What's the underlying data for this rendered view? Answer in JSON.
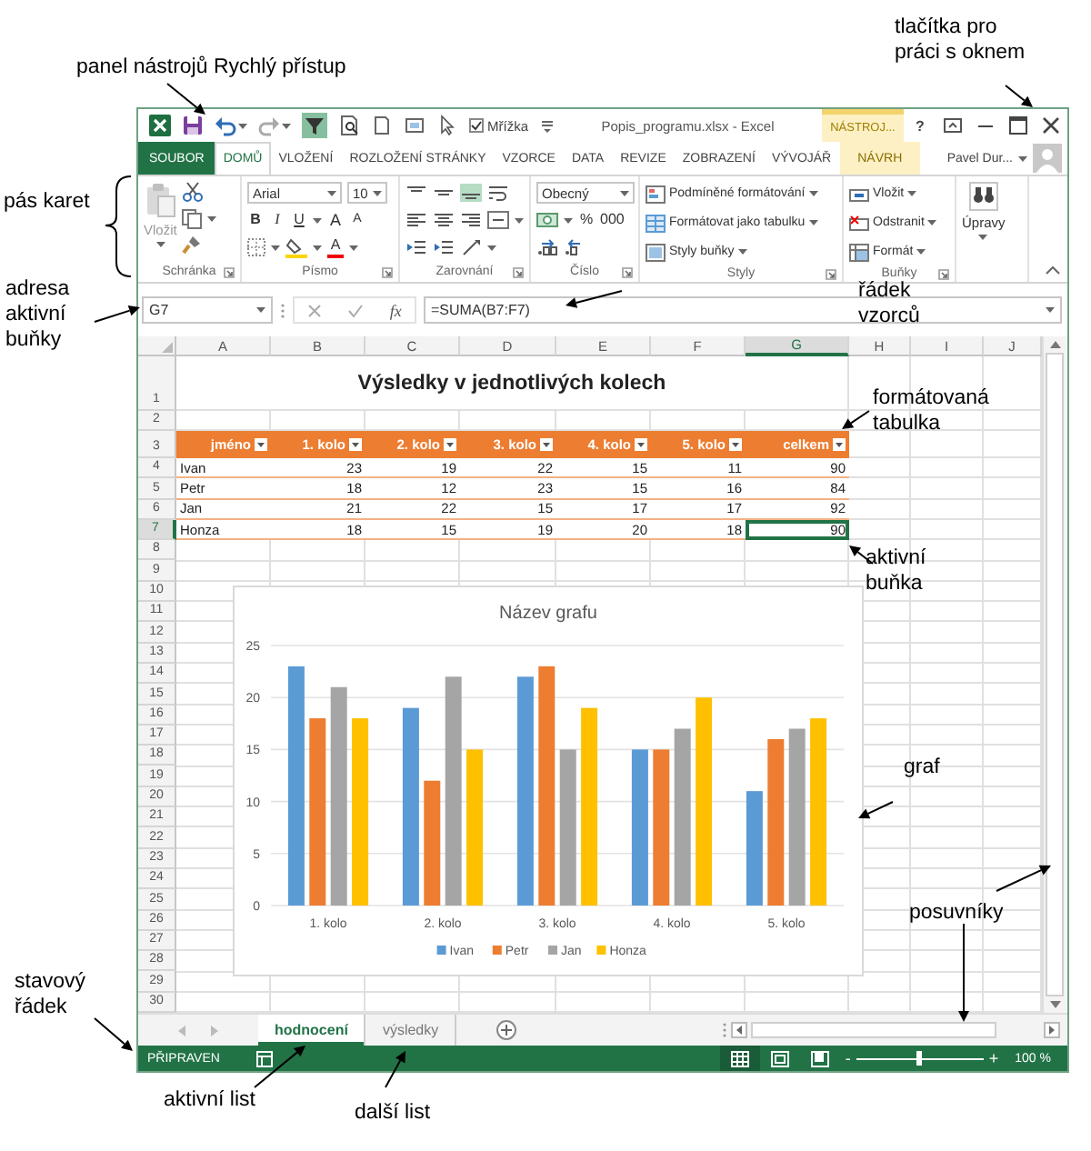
{
  "window": {
    "title": "Popis_programu.xlsx - Excel",
    "context_label": "NÁSTROJ...",
    "help": "?",
    "grid_option": {
      "label": "Mřížka",
      "checked": true
    }
  },
  "ribbon_tabs": [
    {
      "label": "SOUBOR",
      "kind": "file",
      "selected": false
    },
    {
      "label": "DOMŮ",
      "kind": "tab",
      "selected": true
    },
    {
      "label": "VLOŽENÍ",
      "kind": "tab",
      "selected": false
    },
    {
      "label": "ROZLOŽENÍ STRÁNKY",
      "kind": "tab",
      "selected": false
    },
    {
      "label": "VZORCE",
      "kind": "tab",
      "selected": false
    },
    {
      "label": "DATA",
      "kind": "tab",
      "selected": false
    },
    {
      "label": "REVIZE",
      "kind": "tab",
      "selected": false
    },
    {
      "label": "ZOBRAZENÍ",
      "kind": "tab",
      "selected": false
    },
    {
      "label": "VÝVOJÁŘ",
      "kind": "tab",
      "selected": false
    },
    {
      "label": "NÁVRH",
      "kind": "contextual",
      "selected": false
    }
  ],
  "user": {
    "name": "Pavel Dur..."
  },
  "ribbon": {
    "clipboard": {
      "label": "Schránka",
      "paste": "Vložit"
    },
    "font": {
      "label": "Písmo",
      "name": "Arial",
      "size": "10",
      "bold": "B",
      "italic": "I",
      "underline": "U",
      "grow": "A",
      "shrink": "A",
      "font_tint": "A"
    },
    "alignment": {
      "label": "Zarovnání"
    },
    "number": {
      "label": "Číslo",
      "format": "Obecný",
      "percent": "%",
      "thousands": "000"
    },
    "styles": {
      "label": "Styly",
      "items": [
        "Podmíněné formátování",
        "Formátovat jako tabulku",
        "Styly buňky"
      ]
    },
    "cells": {
      "label": "Buňky",
      "items": [
        "Vložit",
        "Odstranit",
        "Formát"
      ]
    },
    "editing": {
      "label": "Úpravy"
    }
  },
  "formula_bar": {
    "cell_address": "G7",
    "fx": "fx",
    "formula": "=SUMA(B7:F7)"
  },
  "sheet": {
    "columns": [
      {
        "label": "A",
        "selected": false
      },
      {
        "label": "B",
        "selected": false
      },
      {
        "label": "C",
        "selected": false
      },
      {
        "label": "D",
        "selected": false
      },
      {
        "label": "E",
        "selected": false
      },
      {
        "label": "F",
        "selected": false
      },
      {
        "label": "G",
        "selected": true
      },
      {
        "label": "H",
        "selected": false
      },
      {
        "label": "I",
        "selected": false
      },
      {
        "label": "J",
        "selected": false
      }
    ],
    "rows": [
      {
        "label": "1",
        "selected": false
      },
      {
        "label": "2",
        "selected": false
      },
      {
        "label": "3",
        "selected": false
      },
      {
        "label": "4",
        "selected": false
      },
      {
        "label": "5",
        "selected": false
      },
      {
        "label": "6",
        "selected": false
      },
      {
        "label": "7",
        "selected": true
      },
      {
        "label": "8",
        "selected": false
      },
      {
        "label": "9",
        "selected": false
      },
      {
        "label": "10",
        "selected": false
      },
      {
        "label": "11",
        "selected": false
      },
      {
        "label": "12",
        "selected": false
      },
      {
        "label": "13",
        "selected": false
      },
      {
        "label": "14",
        "selected": false
      },
      {
        "label": "15",
        "selected": false
      },
      {
        "label": "16",
        "selected": false
      },
      {
        "label": "17",
        "selected": false
      },
      {
        "label": "18",
        "selected": false
      },
      {
        "label": "19",
        "selected": false
      },
      {
        "label": "20",
        "selected": false
      },
      {
        "label": "21",
        "selected": false
      },
      {
        "label": "22",
        "selected": false
      },
      {
        "label": "23",
        "selected": false
      },
      {
        "label": "24",
        "selected": false
      },
      {
        "label": "25",
        "selected": false
      },
      {
        "label": "26",
        "selected": false
      },
      {
        "label": "27",
        "selected": false
      },
      {
        "label": "28",
        "selected": false
      },
      {
        "label": "29",
        "selected": false
      },
      {
        "label": "30",
        "selected": false
      }
    ],
    "title": "Výsledky v jednotlivých kolech",
    "table": {
      "columns": [
        "jméno",
        "1. kolo",
        "2. kolo",
        "3. kolo",
        "4. kolo",
        "5. kolo",
        "celkem"
      ],
      "rows": [
        {
          "cells": [
            {
              "text": "Ivan",
              "selected": false
            },
            {
              "text": "23",
              "selected": false
            },
            {
              "text": "19",
              "selected": false
            },
            {
              "text": "22",
              "selected": false
            },
            {
              "text": "15",
              "selected": false
            },
            {
              "text": "11",
              "selected": false
            },
            {
              "text": "90",
              "selected": false
            }
          ]
        },
        {
          "cells": [
            {
              "text": "Petr",
              "selected": false
            },
            {
              "text": "18",
              "selected": false
            },
            {
              "text": "12",
              "selected": false
            },
            {
              "text": "23",
              "selected": false
            },
            {
              "text": "15",
              "selected": false
            },
            {
              "text": "16",
              "selected": false
            },
            {
              "text": "84",
              "selected": false
            }
          ]
        },
        {
          "cells": [
            {
              "text": "Jan",
              "selected": false
            },
            {
              "text": "21",
              "selected": false
            },
            {
              "text": "22",
              "selected": false
            },
            {
              "text": "15",
              "selected": false
            },
            {
              "text": "17",
              "selected": false
            },
            {
              "text": "17",
              "selected": false
            },
            {
              "text": "92",
              "selected": false
            }
          ]
        },
        {
          "cells": [
            {
              "text": "Honza",
              "selected": false
            },
            {
              "text": "18",
              "selected": false
            },
            {
              "text": "15",
              "selected": false
            },
            {
              "text": "19",
              "selected": false
            },
            {
              "text": "20",
              "selected": false
            },
            {
              "text": "18",
              "selected": false
            },
            {
              "text": "90",
              "selected": true
            }
          ]
        }
      ]
    }
  },
  "chart": {
    "chart_data": {
      "type": "bar",
      "title": "Název grafu",
      "categories": [
        "1. kolo",
        "2. kolo",
        "3. kolo",
        "4. kolo",
        "5. kolo"
      ],
      "series": [
        {
          "name": "Ivan",
          "color": "#5b9bd5",
          "values": [
            23,
            19,
            22,
            15,
            11
          ]
        },
        {
          "name": "Petr",
          "color": "#ed7d31",
          "values": [
            18,
            12,
            23,
            15,
            16
          ]
        },
        {
          "name": "Jan",
          "color": "#a5a5a5",
          "values": [
            21,
            22,
            15,
            17,
            17
          ]
        },
        {
          "name": "Honza",
          "color": "#ffc000",
          "values": [
            18,
            15,
            19,
            20,
            18
          ]
        }
      ],
      "ylim": [
        0,
        25
      ],
      "yticks": [
        0,
        5,
        10,
        15,
        20,
        25
      ],
      "grid": true,
      "legend": true
    }
  },
  "sheet_tabs": [
    {
      "label": "hodnocení",
      "selected": true
    },
    {
      "label": "výsledky",
      "selected": false
    }
  ],
  "status_bar": {
    "status": "PŘIPRAVEN",
    "zoom_minus": "-",
    "zoom_plus": "+",
    "zoom": {
      "level": 0.5
    },
    "zoom_value": "100 %"
  },
  "annotations": [
    {
      "text": "panel nástrojů Rychlý přístup"
    },
    {
      "text": "tlačítka pro práci s oknem"
    },
    {
      "text": "pás karet"
    },
    {
      "text": "adresa aktivní buňky"
    },
    {
      "text": "řádek vzorců"
    },
    {
      "text": "formátovaná tabulka"
    },
    {
      "text": "aktivní buňka"
    },
    {
      "text": "graf"
    },
    {
      "text": "posuvníky"
    },
    {
      "text": "stavový řádek"
    },
    {
      "text": "aktivní list"
    },
    {
      "text": "další list"
    }
  ]
}
